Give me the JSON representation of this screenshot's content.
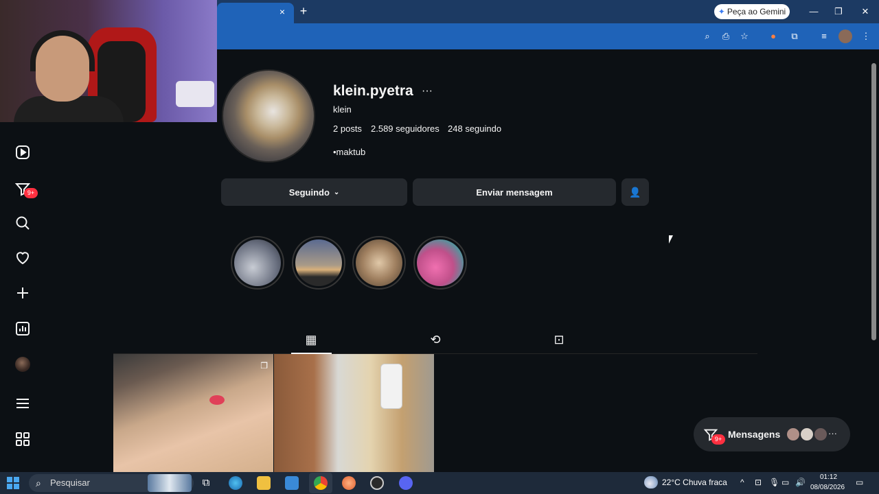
{
  "browser": {
    "gemini_button": "Peça ao Gemini",
    "tab_close": "×",
    "new_tab": "+",
    "window_controls": [
      "—",
      "❐",
      "✕"
    ]
  },
  "nav": {
    "notification_badge": "9+"
  },
  "profile": {
    "username": "klein.pyetra",
    "more": "···",
    "full_name": "klein",
    "posts_count": "2",
    "posts_label": "posts",
    "followers_count": "2.589",
    "followers_label": "seguidores",
    "following_count": "248",
    "following_label": "seguindo",
    "bio": "•maktub",
    "following_button": "Seguindo",
    "message_button": "Enviar mensagem"
  },
  "highlights": [
    {
      "color": "#6a7080"
    },
    {
      "color": "#8a8070"
    },
    {
      "color": "#a08060"
    },
    {
      "color": "#c0508a"
    }
  ],
  "messages": {
    "label": "Mensagens",
    "badge": "9+",
    "more": "···"
  },
  "taskbar": {
    "search_placeholder": "Pesquisar",
    "weather": "22°C  Chuva fraca",
    "time": "01:12",
    "date": "08/08/2026"
  },
  "colors": {
    "background": "#0c1014",
    "button": "#25292e",
    "badge": "#ff3040",
    "browser_toolbar": "#1f63b8"
  }
}
